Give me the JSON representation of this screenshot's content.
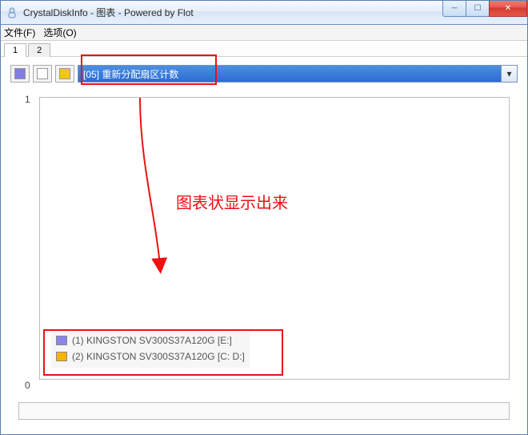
{
  "window": {
    "title": "CrystalDiskInfo - 图表 - Powered by Flot"
  },
  "win_controls": {
    "min": "─",
    "max": "☐",
    "close": "✕"
  },
  "menu": {
    "file": "文件(F)",
    "options": "选项(O)"
  },
  "tabs": [
    "1",
    "2"
  ],
  "toolbar": {
    "swatch_colors": [
      "#7f7fe0",
      "#ffffff",
      "#f5c518"
    ]
  },
  "dropdown": {
    "selected": "[05] 重新分配扇区计数"
  },
  "annotation": {
    "text": "图表状显示出来"
  },
  "legend": {
    "items": [
      {
        "label": "(1) KINGSTON SV300S37A120G [E:]",
        "color": "#8a86e8"
      },
      {
        "label": "(2) KINGSTON SV300S37A120G [C: D:]",
        "color": "#f5b400"
      }
    ]
  },
  "chart_data": {
    "type": "line",
    "title": "",
    "xlabel": "",
    "ylabel": "",
    "ylim": [
      0,
      1
    ],
    "x": [],
    "series": [
      {
        "name": "(1) KINGSTON SV300S37A120G [E:]",
        "values": []
      },
      {
        "name": "(2) KINGSTON SV300S37A120G [C: D:]",
        "values": []
      }
    ],
    "y_ticks": [
      "1",
      "0"
    ]
  }
}
